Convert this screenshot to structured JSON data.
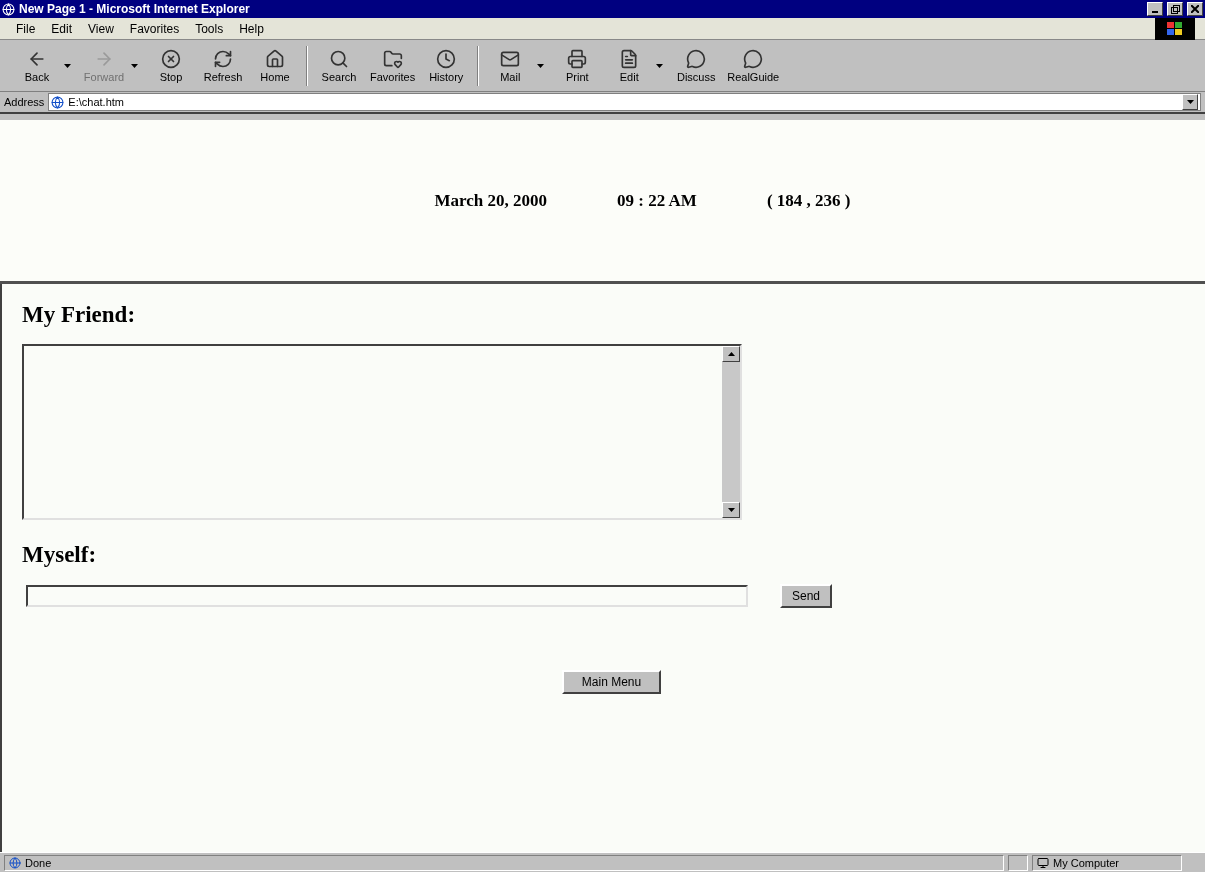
{
  "window": {
    "title": "New Page 1 - Microsoft Internet Explorer"
  },
  "menu": [
    "File",
    "Edit",
    "View",
    "Favorites",
    "Tools",
    "Help"
  ],
  "toolbar": [
    {
      "label": "Back",
      "disabled": false,
      "dropdown": true
    },
    {
      "label": "Forward",
      "disabled": true,
      "dropdown": true
    },
    {
      "label": "Stop",
      "disabled": false,
      "dropdown": false
    },
    {
      "label": "Refresh",
      "disabled": false,
      "dropdown": false
    },
    {
      "label": "Home",
      "disabled": false,
      "dropdown": false
    },
    {
      "label": "Search",
      "disabled": false,
      "dropdown": false
    },
    {
      "label": "Favorites",
      "disabled": false,
      "dropdown": false
    },
    {
      "label": "History",
      "disabled": false,
      "dropdown": false
    },
    {
      "label": "Mail",
      "disabled": false,
      "dropdown": true
    },
    {
      "label": "Print",
      "disabled": false,
      "dropdown": false
    },
    {
      "label": "Edit",
      "disabled": false,
      "dropdown": true
    },
    {
      "label": "Discuss",
      "disabled": false,
      "dropdown": false
    },
    {
      "label": "RealGuide",
      "disabled": false,
      "dropdown": false
    }
  ],
  "address": {
    "label": "Address",
    "value": "E:\\chat.htm"
  },
  "header_frame": {
    "date": "March 20, 2000",
    "time": "09 : 22 AM",
    "coordinates": "( 184 , 236 )"
  },
  "chat_frame": {
    "friend_label": "My Friend:",
    "myself_label": "Myself:",
    "send_button": "Send",
    "main_menu_button": "Main Menu"
  },
  "status_bar": {
    "text": "Done",
    "zone": "My Computer"
  }
}
